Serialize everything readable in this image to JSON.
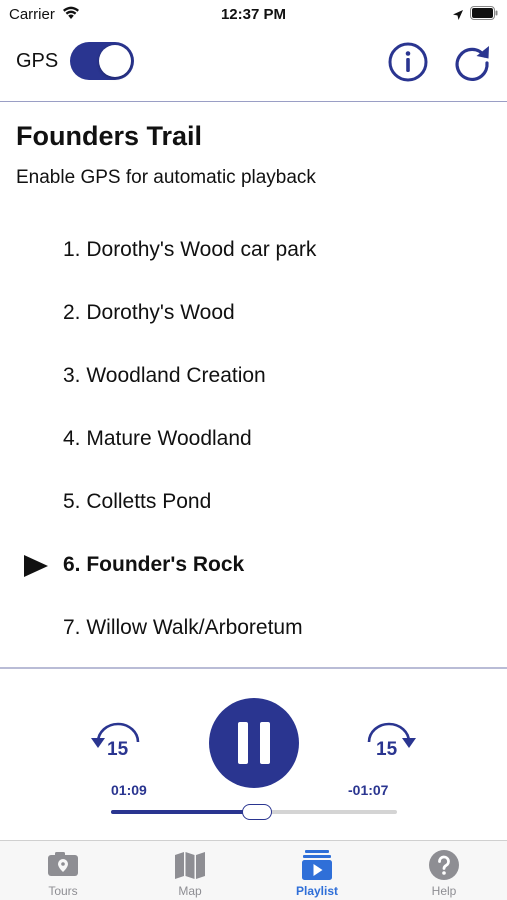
{
  "status_bar": {
    "carrier": "Carrier",
    "time": "12:37 PM"
  },
  "toolbar": {
    "gps_label": "GPS",
    "gps_enabled": true
  },
  "trail": {
    "title": "Founders Trail",
    "subtitle": "Enable GPS for automatic playback"
  },
  "playlist": {
    "items": [
      {
        "label": "1. Dorothy's Wood car park",
        "active": false
      },
      {
        "label": "2. Dorothy's Wood",
        "active": false
      },
      {
        "label": "3. Woodland Creation",
        "active": false
      },
      {
        "label": "4. Mature Woodland",
        "active": false
      },
      {
        "label": "5. Colletts Pond",
        "active": false
      },
      {
        "label": "6. Founder's Rock",
        "active": true
      },
      {
        "label": "7. Willow Walk/Arboretum",
        "active": false
      }
    ]
  },
  "player": {
    "skip_back_seconds": "15",
    "skip_forward_seconds": "15",
    "elapsed": "01:09",
    "remaining": "-01:07",
    "progress_fraction": 0.51,
    "state": "playing"
  },
  "tabs": [
    {
      "label": "Tours",
      "icon": "map-pin-icon",
      "active": false
    },
    {
      "label": "Map",
      "icon": "map-icon",
      "active": false
    },
    {
      "label": "Playlist",
      "icon": "playlist-icon",
      "active": true
    },
    {
      "label": "Help",
      "icon": "help-icon",
      "active": false
    }
  ],
  "colors": {
    "accent": "#2a3590",
    "tab_active": "#2f6fd8",
    "tab_inactive": "#8e8e93"
  }
}
